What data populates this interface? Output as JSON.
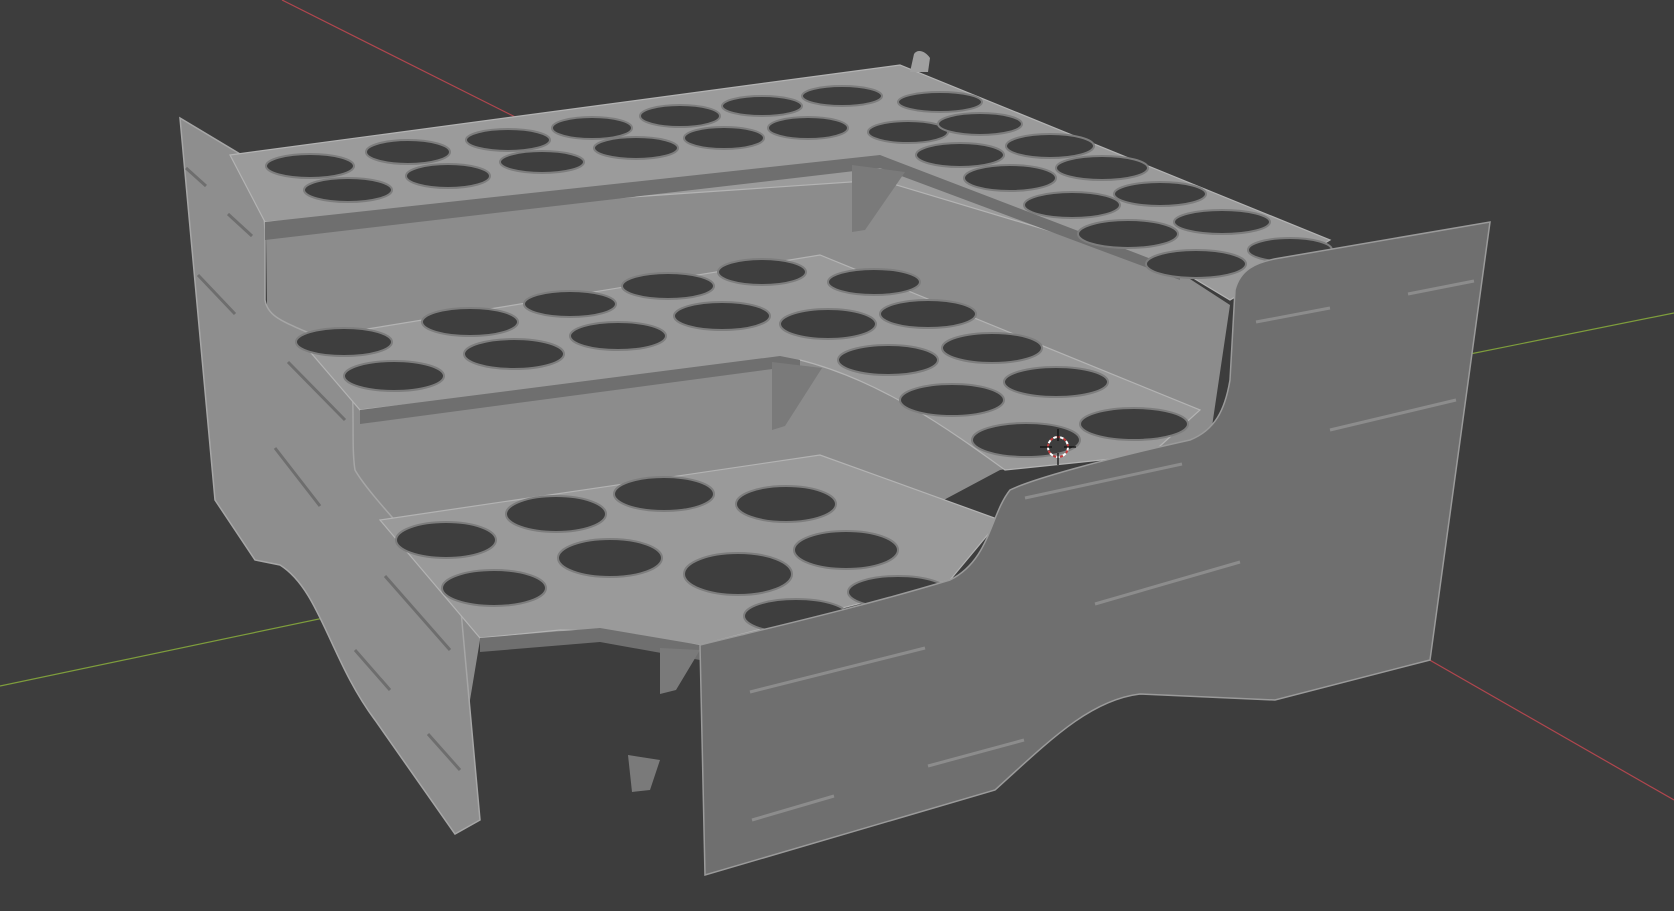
{
  "viewport": {
    "background": "#3d3d3d",
    "axis_x_color": "#b0464e",
    "axis_y_color": "#7e9d3c",
    "model_light": "#9b9b9b",
    "model_mid": "#8a8a8a",
    "model_dark": "#6f6f6f",
    "model_edge": "#b3b3b3",
    "hole_color": "#3e3e3e",
    "cursor_icon": "3d-cursor-icon"
  }
}
